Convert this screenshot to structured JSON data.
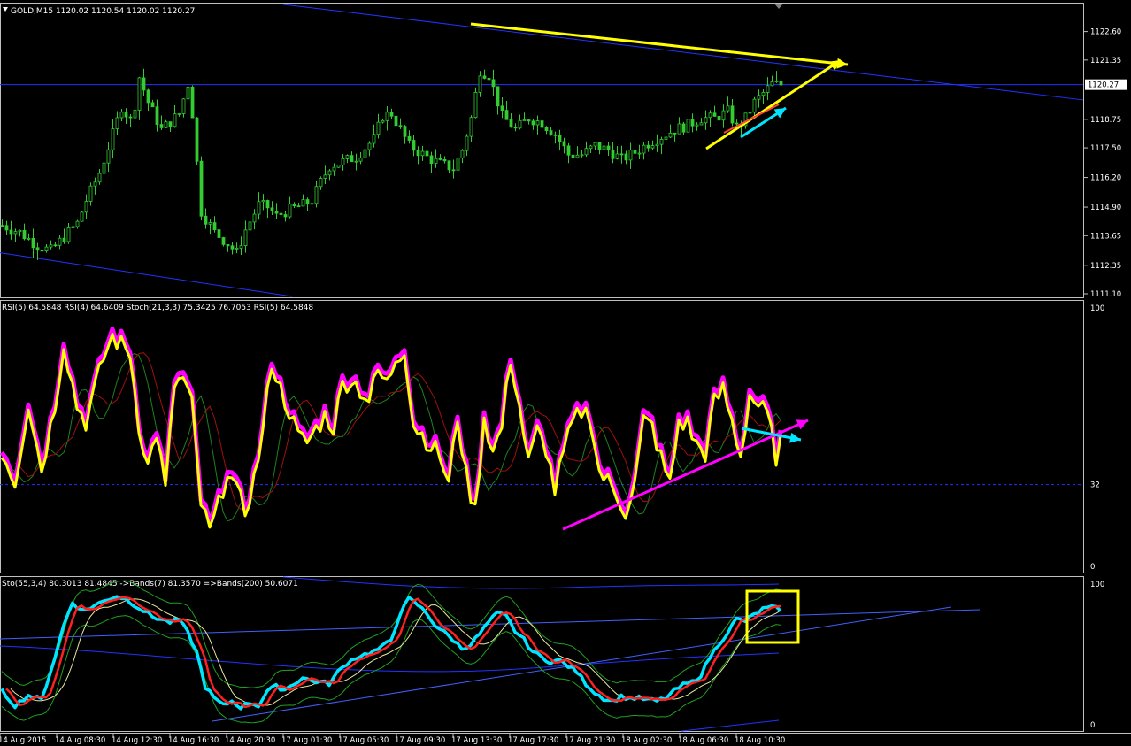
{
  "panes": {
    "price": {
      "header": "GOLD,M15  1120.02 1120.54 1120.02 1120.27",
      "current_price": "1120.27"
    },
    "rsi": {
      "header": "RSI(5) 64.5848  RSI(4) 64.6409  Stoch(21,3,3) 75.3425 76.7053  RSI(5) 64.5848"
    },
    "sto": {
      "header": "Sto(55,3,4) 80.3013 81.4845   ->Bands(7) 81.3570   =>Bands(200) 50.6071"
    }
  },
  "colors": {
    "candle": "#33cc33",
    "trendline": "#2233ff",
    "yellow": "#ffff00",
    "cyan": "#00e5ff",
    "magenta": "#ff00ff",
    "red": "#ff2020",
    "axis": "#c0c0c0"
  },
  "chart_data": [
    {
      "type": "candlestick",
      "title": "GOLD,M15",
      "ylim": [
        1111.1,
        1123.4
      ],
      "y_ticks": [
        "1122.60",
        "1121.35",
        "1118.75",
        "1117.50",
        "1116.20",
        "1114.90",
        "1113.65",
        "1112.35",
        "1111.10"
      ],
      "last": 1120.27,
      "close_path": [
        [
          0,
          1114.1
        ],
        [
          4,
          1113.8
        ],
        [
          8,
          1113.2
        ],
        [
          11,
          1113.0
        ],
        [
          14,
          1113.6
        ],
        [
          17,
          1114.2
        ],
        [
          19,
          1115.2
        ],
        [
          22,
          1116.4
        ],
        [
          25,
          1118.1
        ],
        [
          27,
          1119.3
        ],
        [
          29,
          1118.7
        ],
        [
          30,
          1119.4
        ],
        [
          31,
          1120.6
        ],
        [
          33,
          1119.5
        ],
        [
          36,
          1118.3
        ],
        [
          40,
          1119.0
        ],
        [
          42,
          1120.3
        ],
        [
          43,
          1119.0
        ],
        [
          45,
          1114.7
        ],
        [
          48,
          1113.8
        ],
        [
          51,
          1113.3
        ],
        [
          53,
          1112.9
        ],
        [
          55,
          1113.9
        ],
        [
          58,
          1115.0
        ],
        [
          60,
          1114.9
        ],
        [
          62,
          1114.5
        ],
        [
          65,
          1114.8
        ],
        [
          68,
          1115.0
        ],
        [
          70,
          1115.2
        ],
        [
          72,
          1116.0
        ],
        [
          74,
          1116.7
        ],
        [
          77,
          1116.9
        ],
        [
          80,
          1117.1
        ],
        [
          84,
          1117.9
        ],
        [
          86,
          1118.9
        ],
        [
          88,
          1119.0
        ],
        [
          90,
          1118.3
        ],
        [
          92,
          1117.6
        ],
        [
          96,
          1117.1
        ],
        [
          99,
          1116.8
        ],
        [
          102,
          1116.6
        ],
        [
          104,
          1117.4
        ],
        [
          106,
          1118.8
        ],
        [
          108,
          1120.9
        ],
        [
          110,
          1120.7
        ],
        [
          113,
          1118.9
        ],
        [
          116,
          1118.3
        ],
        [
          119,
          1118.8
        ],
        [
          122,
          1118.6
        ],
        [
          125,
          1118.1
        ],
        [
          128,
          1117.2
        ],
        [
          131,
          1117.2
        ],
        [
          134,
          1117.6
        ],
        [
          137,
          1117.4
        ],
        [
          140,
          1117.0
        ],
        [
          143,
          1117.3
        ],
        [
          146,
          1117.7
        ],
        [
          149,
          1118.0
        ],
        [
          152,
          1118.3
        ],
        [
          155,
          1118.5
        ],
        [
          158,
          1118.8
        ],
        [
          161,
          1118.8
        ],
        [
          164,
          1119.1
        ],
        [
          166,
          1118.4
        ],
        [
          168,
          1118.8
        ],
        [
          170,
          1119.5
        ],
        [
          172,
          1119.9
        ],
        [
          174,
          1120.3
        ],
        [
          176,
          1120.27
        ]
      ]
    },
    {
      "type": "line",
      "title": "RSI(5) / RSI(4) / Stoch(21,3,3)",
      "ylim": [
        0,
        100
      ],
      "y_ticks": [
        "100",
        "32",
        "0"
      ],
      "level": 32,
      "series": [
        {
          "name": "RSI(5)",
          "values": [
            [
              0,
              45
            ],
            [
              3,
              33
            ],
            [
              6,
              63
            ],
            [
              9,
              38
            ],
            [
              12,
              62
            ],
            [
              14,
              86
            ],
            [
              17,
              62
            ],
            [
              19,
              56
            ],
            [
              21,
              68
            ],
            [
              23,
              80
            ],
            [
              25,
              88
            ],
            [
              27,
              85
            ],
            [
              29,
              82
            ],
            [
              31,
              55
            ],
            [
              33,
              39
            ],
            [
              35,
              52
            ],
            [
              37,
              30
            ],
            [
              39,
              70
            ],
            [
              41,
              72
            ],
            [
              43,
              62
            ],
            [
              45,
              25
            ],
            [
              47,
              14
            ],
            [
              49,
              24
            ],
            [
              51,
              38
            ],
            [
              53,
              29
            ],
            [
              55,
              22
            ],
            [
              57,
              34
            ],
            [
              59,
              52
            ],
            [
              61,
              79
            ],
            [
              63,
              68
            ],
            [
              65,
              60
            ],
            [
              67,
              50
            ],
            [
              69,
              48
            ],
            [
              71,
              53
            ],
            [
              73,
              58
            ],
            [
              75,
              54
            ],
            [
              77,
              70
            ],
            [
              79,
              72
            ],
            [
              81,
              68
            ],
            [
              83,
              64
            ],
            [
              85,
              75
            ],
            [
              87,
              70
            ],
            [
              89,
              80
            ],
            [
              91,
              84
            ],
            [
              93,
              55
            ],
            [
              95,
              51
            ],
            [
              97,
              47
            ],
            [
              99,
              43
            ],
            [
              101,
              32
            ],
            [
              103,
              58
            ],
            [
              105,
              35
            ],
            [
              107,
              22
            ],
            [
              109,
              58
            ],
            [
              111,
              44
            ],
            [
              113,
              54
            ],
            [
              115,
              80
            ],
            [
              117,
              62
            ],
            [
              119,
              40
            ],
            [
              121,
              52
            ],
            [
              123,
              46
            ],
            [
              125,
              30
            ],
            [
              127,
              44
            ],
            [
              129,
              55
            ],
            [
              131,
              60
            ],
            [
              133,
              58
            ],
            [
              135,
              37
            ],
            [
              137,
              33
            ],
            [
              139,
              28
            ],
            [
              141,
              22
            ],
            [
              143,
              32
            ],
            [
              145,
              56
            ],
            [
              147,
              54
            ],
            [
              149,
              42
            ],
            [
              151,
              32
            ],
            [
              153,
              56
            ],
            [
              155,
              55
            ],
            [
              157,
              47
            ],
            [
              159,
              44
            ],
            [
              161,
              63
            ],
            [
              163,
              68
            ],
            [
              165,
              56
            ],
            [
              167,
              43
            ],
            [
              169,
              66
            ],
            [
              171,
              62
            ],
            [
              173,
              58
            ],
            [
              175,
              43
            ],
            [
              177,
              53
            ]
          ]
        },
        {
          "name": "RSI(4)",
          "values": "overlay of RSI(5), thicker magenta"
        },
        {
          "name": "Stoch(21,3,3)",
          "values": "lagging thin green/red lines"
        }
      ]
    },
    {
      "type": "line",
      "title": "Sto(55,3,4) with Bands",
      "ylim": [
        0,
        100
      ],
      "y_ticks": [
        "100",
        "0"
      ],
      "series": [
        {
          "name": "Sto(55,3,4)",
          "values": [
            [
              0,
              25
            ],
            [
              3,
              15
            ],
            [
              6,
              22
            ],
            [
              9,
              19
            ],
            [
              12,
              48
            ],
            [
              14,
              70
            ],
            [
              16,
              86
            ],
            [
              18,
              80
            ],
            [
              20,
              82
            ],
            [
              22,
              85
            ],
            [
              24,
              88
            ],
            [
              26,
              90
            ],
            [
              28,
              88
            ],
            [
              30,
              84
            ],
            [
              32,
              80
            ],
            [
              34,
              76
            ],
            [
              36,
              74
            ],
            [
              38,
              72
            ],
            [
              40,
              74
            ],
            [
              42,
              65
            ],
            [
              44,
              52
            ],
            [
              46,
              28
            ],
            [
              48,
              20
            ],
            [
              50,
              15
            ],
            [
              52,
              18
            ],
            [
              54,
              14
            ],
            [
              56,
              17
            ],
            [
              58,
              15
            ],
            [
              60,
              25
            ],
            [
              62,
              28
            ],
            [
              64,
              26
            ],
            [
              66,
              30
            ],
            [
              68,
              34
            ],
            [
              70,
              32
            ],
            [
              72,
              31
            ],
            [
              74,
              30
            ],
            [
              76,
              38
            ],
            [
              78,
              44
            ],
            [
              80,
              48
            ],
            [
              82,
              50
            ],
            [
              84,
              52
            ],
            [
              86,
              55
            ],
            [
              88,
              60
            ],
            [
              90,
              78
            ],
            [
              92,
              88
            ],
            [
              94,
              84
            ],
            [
              96,
              78
            ],
            [
              98,
              70
            ],
            [
              100,
              65
            ],
            [
              102,
              60
            ],
            [
              104,
              54
            ],
            [
              106,
              57
            ],
            [
              108,
              64
            ],
            [
              110,
              72
            ],
            [
              112,
              78
            ],
            [
              114,
              76
            ],
            [
              116,
              66
            ],
            [
              118,
              60
            ],
            [
              120,
              52
            ],
            [
              122,
              48
            ],
            [
              124,
              45
            ],
            [
              126,
              46
            ],
            [
              128,
              42
            ],
            [
              130,
              38
            ],
            [
              132,
              30
            ],
            [
              134,
              24
            ],
            [
              136,
              20
            ],
            [
              138,
              18
            ],
            [
              140,
              21
            ],
            [
              142,
              20
            ],
            [
              144,
              20
            ],
            [
              146,
              19
            ],
            [
              148,
              18
            ],
            [
              150,
              20
            ],
            [
              152,
              25
            ],
            [
              154,
              29
            ],
            [
              156,
              31
            ],
            [
              158,
              36
            ],
            [
              160,
              48
            ],
            [
              162,
              57
            ],
            [
              164,
              65
            ],
            [
              166,
              74
            ],
            [
              168,
              73
            ],
            [
              170,
              77
            ],
            [
              172,
              81
            ],
            [
              174,
              82
            ],
            [
              176,
              81
            ]
          ]
        }
      ]
    }
  ],
  "x_axis": {
    "labels": [
      "14 Aug 2015",
      "14 Aug 08:30",
      "14 Aug 12:30",
      "14 Aug 16:30",
      "14 Aug 20:30",
      "17 Aug 01:30",
      "17 Aug 05:30",
      "17 Aug 09:30",
      "17 Aug 13:30",
      "17 Aug 17:30",
      "17 Aug 21:30",
      "18 Aug 02:30",
      "18 Aug 06:30",
      "18 Aug 10:30"
    ]
  }
}
